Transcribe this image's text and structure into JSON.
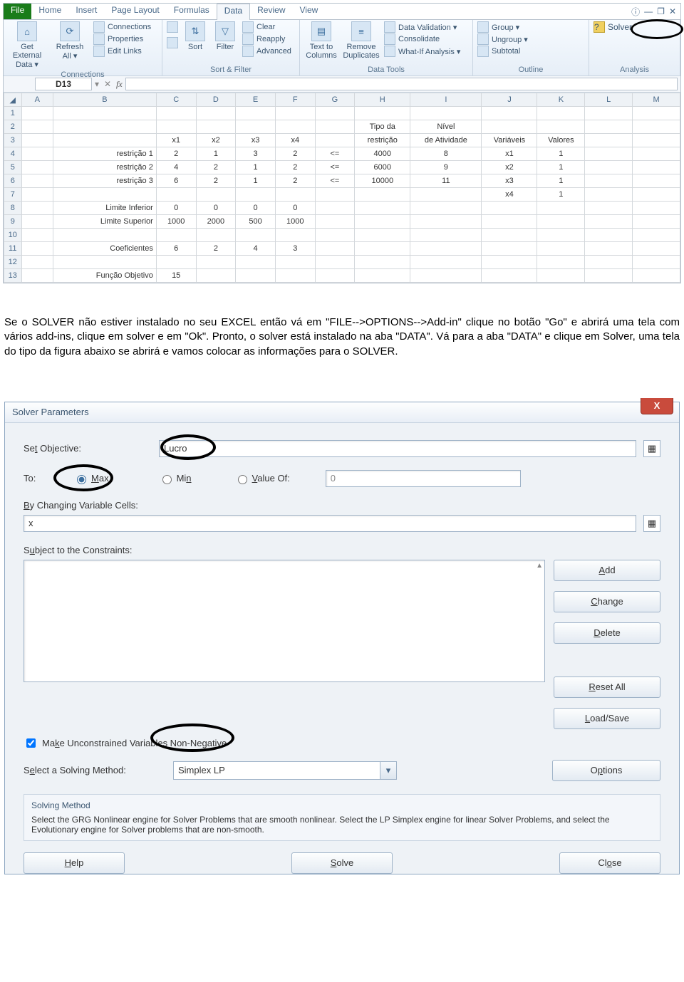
{
  "ribbon": {
    "tabs": [
      "File",
      "Home",
      "Insert",
      "Page Layout",
      "Formulas",
      "Data",
      "Review",
      "View"
    ],
    "active": "Data",
    "groups": {
      "ext": {
        "getdata": "Get External\nData ▾",
        "refresh": "Refresh\nAll ▾",
        "conns": "Connections",
        "props": "Properties",
        "links": "Edit Links",
        "label": "Connections"
      },
      "sort": {
        "sort": "Sort",
        "filter": "Filter",
        "clear": "Clear",
        "reapply": "Reapply",
        "advanced": "Advanced",
        "label": "Sort & Filter"
      },
      "dtools": {
        "ttc": "Text to\nColumns",
        "rdup": "Remove\nDuplicates",
        "dval": "Data Validation ▾",
        "cons": "Consolidate",
        "whatif": "What-If Analysis ▾",
        "label": "Data Tools"
      },
      "outline": {
        "group": "Group ▾",
        "ungroup": "Ungroup ▾",
        "subtotal": "Subtotal",
        "label": "Outline"
      },
      "analysis": {
        "solver": "Solver",
        "label": "Analysis"
      }
    }
  },
  "namebox": "D13",
  "cols": [
    "A",
    "B",
    "C",
    "D",
    "E",
    "F",
    "G",
    "H",
    "I",
    "J",
    "K",
    "L",
    "M"
  ],
  "rows": [
    {
      "r": 1,
      "c": {}
    },
    {
      "r": 2,
      "c": {
        "H": "Tipo da",
        "I": "Nível"
      }
    },
    {
      "r": 3,
      "c": {
        "C": "x1",
        "D": "x2",
        "E": "x3",
        "F": "x4",
        "H": "restrição",
        "I": "de Atividade",
        "J": "Variáveis",
        "K": "Valores"
      }
    },
    {
      "r": 4,
      "c": {
        "B": "restrição 1",
        "C": "2",
        "D": "1",
        "E": "3",
        "F": "2",
        "G": "<=",
        "H": "4000",
        "I": "8",
        "J": "x1",
        "K": "1"
      }
    },
    {
      "r": 5,
      "c": {
        "B": "restrição 2",
        "C": "4",
        "D": "2",
        "E": "1",
        "F": "2",
        "G": "<=",
        "H": "6000",
        "I": "9",
        "J": "x2",
        "K": "1"
      }
    },
    {
      "r": 6,
      "c": {
        "B": "restrição 3",
        "C": "6",
        "D": "2",
        "E": "1",
        "F": "2",
        "G": "<=",
        "H": "10000",
        "I": "11",
        "J": "x3",
        "K": "1"
      }
    },
    {
      "r": 7,
      "c": {
        "J": "x4",
        "K": "1"
      }
    },
    {
      "r": 8,
      "c": {
        "B": "Limite Inferior",
        "C": "0",
        "D": "0",
        "E": "0",
        "F": "0"
      }
    },
    {
      "r": 9,
      "c": {
        "B": "Limite Superior",
        "C": "1000",
        "D": "2000",
        "E": "500",
        "F": "1000"
      }
    },
    {
      "r": 10,
      "c": {}
    },
    {
      "r": 11,
      "c": {
        "B": "Coeficientes",
        "C": "6",
        "D": "2",
        "E": "4",
        "F": "3"
      }
    },
    {
      "r": 12,
      "c": {}
    },
    {
      "r": 13,
      "c": {
        "B": "Função Objetivo",
        "C": "15"
      }
    }
  ],
  "paragraph": "Se o SOLVER não estiver instalado no seu EXCEL então vá em \"FILE-->OPTIONS-->Add-in\" clique  no botão  \"Go\" e abrirá uma tela com vários add-ins, clique em solver e em \"Ok\". Pronto, o solver está instalado na aba \"DATA\". Vá para a aba \"DATA\" e clique em Solver, uma tela do tipo da figura abaixo se abrirá e vamos colocar as informações para o SOLVER.",
  "solver": {
    "title": "Solver Parameters",
    "setobj_label": "Set Objective:",
    "setobj_value": "Lucro",
    "to_label": "To:",
    "max": "Max",
    "min": "Min",
    "valof": "Value Of:",
    "valof_value": "0",
    "bycells_label": "By Changing Variable Cells:",
    "bycells_value": "x",
    "subject_label": "Subject to the Constraints:",
    "add": "Add",
    "change": "Change",
    "delete": "Delete",
    "reset": "Reset All",
    "loadsave": "Load/Save",
    "nonneg": "Make Unconstrained Variables Non-Negative",
    "method_label": "Select a Solving Method:",
    "method_value": "Simplex LP",
    "options": "Options",
    "info_hd": "Solving Method",
    "info_body": "Select the GRG Nonlinear engine for Solver Problems that are smooth nonlinear. Select the LP Simplex engine for linear Solver Problems, and select the Evolutionary engine for Solver problems that are non-smooth.",
    "help": "Help",
    "solve": "Solve",
    "close": "Close"
  }
}
